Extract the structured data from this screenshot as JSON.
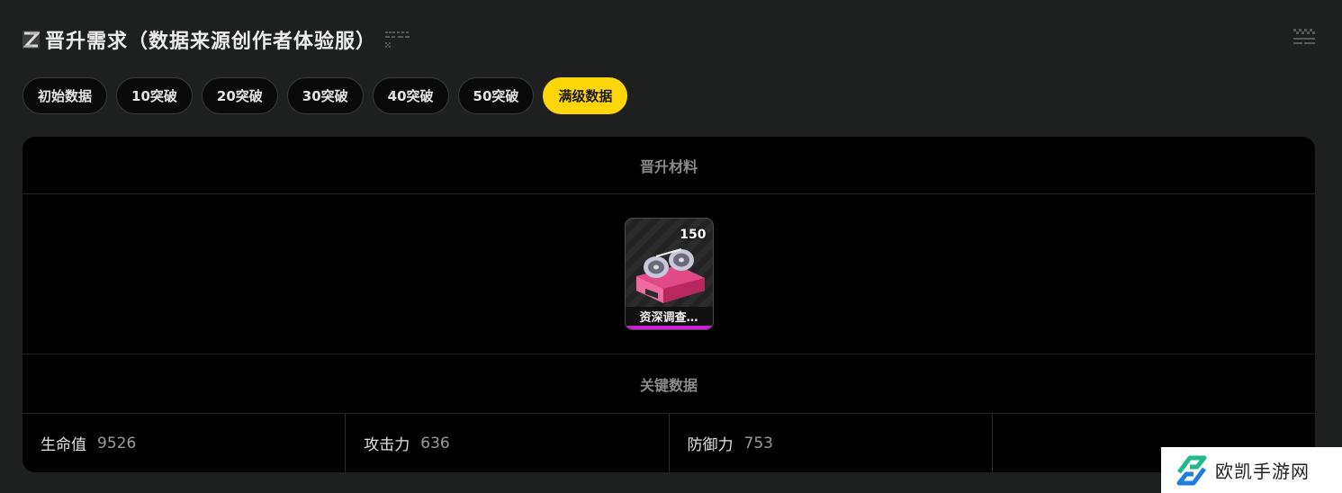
{
  "header": {
    "title": "晋升需求（数据来源创作者体验服）"
  },
  "tabs": [
    {
      "label": "初始数据",
      "active": false
    },
    {
      "label": "10突破",
      "active": false
    },
    {
      "label": "20突破",
      "active": false
    },
    {
      "label": "30突破",
      "active": false
    },
    {
      "label": "40突破",
      "active": false
    },
    {
      "label": "50突破",
      "active": false
    },
    {
      "label": "满级数据",
      "active": true
    }
  ],
  "materials_section": {
    "title": "晋升材料",
    "items": [
      {
        "name": "资深调查…",
        "count": "150",
        "icon": "tape-reel-icon",
        "rarity_color": "#c81ed6"
      }
    ]
  },
  "stats_section": {
    "title": "关键数据",
    "stats": [
      {
        "label": "生命值",
        "value": "9526"
      },
      {
        "label": "攻击力",
        "value": "636"
      },
      {
        "label": "防御力",
        "value": "753"
      },
      {
        "label": "",
        "value": ""
      }
    ]
  },
  "watermark": {
    "text": "欧凯手游网"
  },
  "colors": {
    "accent": "#ffd60a",
    "background": "#1e1f1f",
    "panel": "#000000",
    "rarity": "#c81ed6"
  }
}
